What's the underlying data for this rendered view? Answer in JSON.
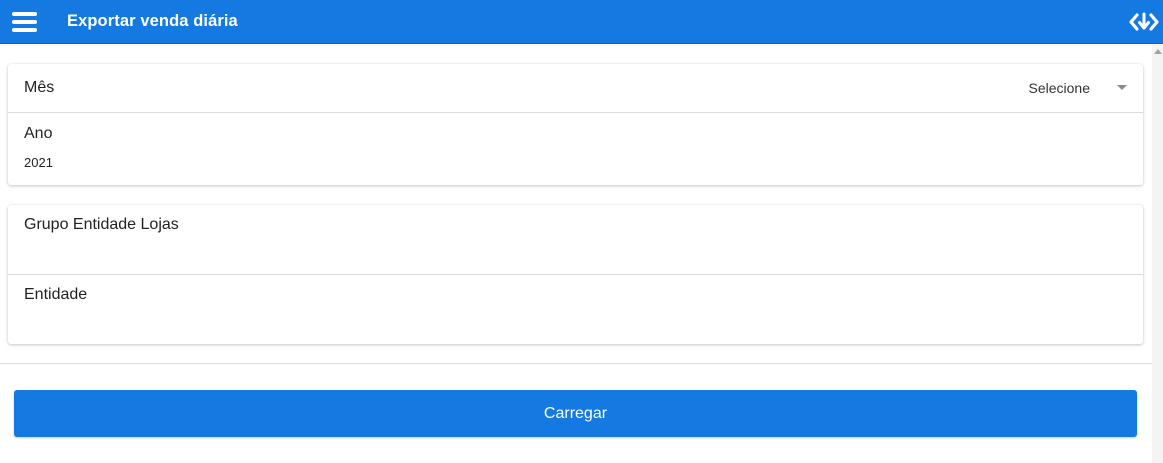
{
  "header": {
    "title": "Exportar venda diária",
    "menu_icon": "hamburger-menu-icon",
    "right_icon": "code-download-icon",
    "background_color": "#1479e0"
  },
  "period_card": {
    "month": {
      "label": "Mês",
      "selected": "Selecione"
    },
    "year": {
      "label": "Ano",
      "value": "2021"
    }
  },
  "entity_card": {
    "group": {
      "label": "Grupo Entidade Lojas",
      "value": ""
    },
    "entity": {
      "label": "Entidade",
      "value": ""
    }
  },
  "actions": {
    "load_label": "Carregar"
  }
}
